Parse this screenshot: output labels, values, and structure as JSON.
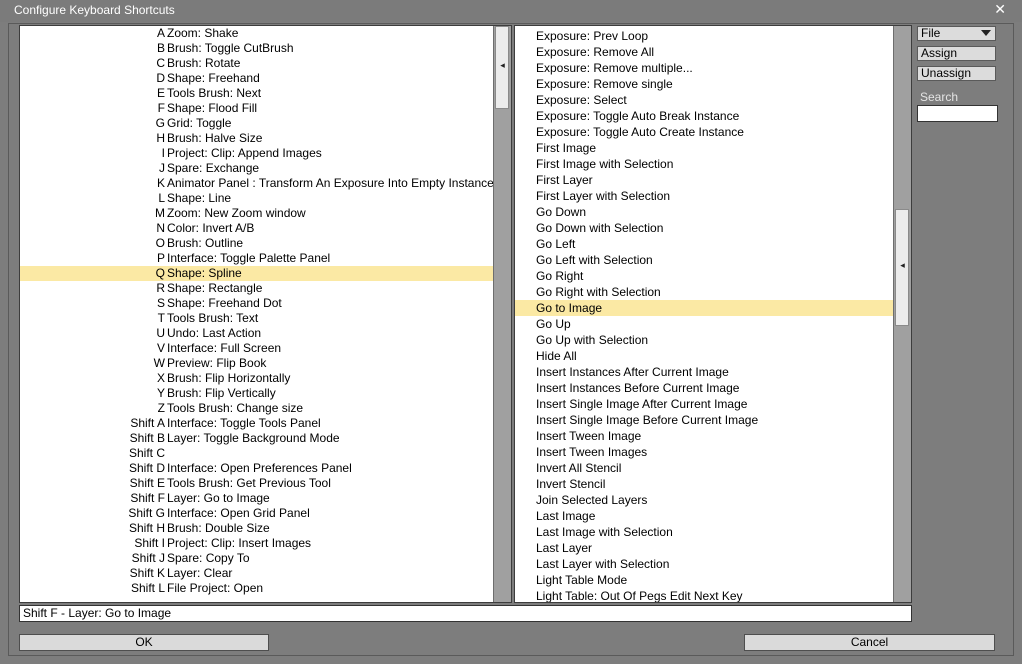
{
  "window": {
    "title": "Configure Keyboard Shortcuts",
    "close_glyph": "✕"
  },
  "shortcuts": [
    {
      "key": "A",
      "cmd": "Zoom: Shake"
    },
    {
      "key": "B",
      "cmd": "Brush: Toggle CutBrush"
    },
    {
      "key": "C",
      "cmd": "Brush: Rotate"
    },
    {
      "key": "D",
      "cmd": "Shape: Freehand"
    },
    {
      "key": "E",
      "cmd": "Tools Brush: Next"
    },
    {
      "key": "F",
      "cmd": "Shape: Flood Fill"
    },
    {
      "key": "G",
      "cmd": "Grid: Toggle"
    },
    {
      "key": "H",
      "cmd": "Brush: Halve Size"
    },
    {
      "key": "I",
      "cmd": "Project: Clip: Append Images"
    },
    {
      "key": "J",
      "cmd": "Spare: Exchange"
    },
    {
      "key": "K",
      "cmd": "Animator Panel : Transform An Exposure Into Empty Instance"
    },
    {
      "key": "L",
      "cmd": "Shape: Line"
    },
    {
      "key": "M",
      "cmd": "Zoom: New Zoom window"
    },
    {
      "key": "N",
      "cmd": "Color: Invert A/B"
    },
    {
      "key": "O",
      "cmd": "Brush: Outline"
    },
    {
      "key": "P",
      "cmd": "Interface: Toggle Palette Panel"
    },
    {
      "key": "Q",
      "cmd": "Shape: Spline"
    },
    {
      "key": "R",
      "cmd": "Shape: Rectangle"
    },
    {
      "key": "S",
      "cmd": "Shape: Freehand Dot"
    },
    {
      "key": "T",
      "cmd": "Tools Brush: Text"
    },
    {
      "key": "U",
      "cmd": "Undo: Last Action"
    },
    {
      "key": "V",
      "cmd": "Interface: Full Screen"
    },
    {
      "key": "W",
      "cmd": "Preview: Flip Book"
    },
    {
      "key": "X",
      "cmd": "Brush: Flip Horizontally"
    },
    {
      "key": "Y",
      "cmd": "Brush: Flip Vertically"
    },
    {
      "key": "Z",
      "cmd": "Tools Brush: Change size"
    },
    {
      "key": "Shift A",
      "cmd": "Interface: Toggle Tools Panel"
    },
    {
      "key": "Shift B",
      "cmd": "Layer: Toggle Background Mode"
    },
    {
      "key": "Shift C",
      "cmd": ""
    },
    {
      "key": "Shift D",
      "cmd": "Interface: Open Preferences Panel"
    },
    {
      "key": "Shift E",
      "cmd": "Tools Brush: Get Previous Tool"
    },
    {
      "key": "Shift F",
      "cmd": "Layer: Go to Image"
    },
    {
      "key": "Shift G",
      "cmd": "Interface: Open Grid Panel"
    },
    {
      "key": "Shift H",
      "cmd": "Brush: Double Size"
    },
    {
      "key": "Shift I",
      "cmd": "Project: Clip: Insert Images"
    },
    {
      "key": "Shift J",
      "cmd": "Spare: Copy To"
    },
    {
      "key": "Shift K",
      "cmd": "Layer: Clear"
    },
    {
      "key": "Shift L",
      "cmd": "File Project: Open"
    }
  ],
  "shortcuts_selected_index": 16,
  "commands": [
    "Exposure: Prev Loop",
    "Exposure: Remove All",
    "Exposure: Remove multiple...",
    "Exposure: Remove single",
    "Exposure: Select",
    "Exposure: Toggle Auto Break Instance",
    "Exposure: Toggle Auto Create Instance",
    "First Image",
    "First Image with Selection",
    "First Layer",
    "First Layer with Selection",
    "Go Down",
    "Go Down with Selection",
    "Go Left",
    "Go Left with Selection",
    "Go Right",
    "Go Right with Selection",
    "Go to Image",
    "Go Up",
    "Go Up with Selection",
    "Hide All",
    "Insert Instances After Current Image",
    "Insert Instances Before Current Image",
    "Insert Single Image After Current Image",
    "Insert Single Image Before Current Image",
    "Insert Tween Image",
    "Insert Tween Images",
    "Invert All Stencil",
    "Invert Stencil",
    "Join Selected Layers",
    "Last Image",
    "Last Image with Selection",
    "Last Layer",
    "Last Layer with Selection",
    "Light Table Mode",
    "Light Table: Out Of Pegs Edit Next Key"
  ],
  "commands_selected_index": 17,
  "side": {
    "file_label": "File",
    "assign_label": "Assign",
    "unassign_label": "Unassign",
    "search_label": "Search",
    "search_value": ""
  },
  "status_text": "Shift F - Layer: Go to Image",
  "buttons": {
    "ok": "OK",
    "cancel": "Cancel"
  },
  "colors": {
    "selection": "#fbe9a4",
    "background": "#7d7d7d"
  }
}
